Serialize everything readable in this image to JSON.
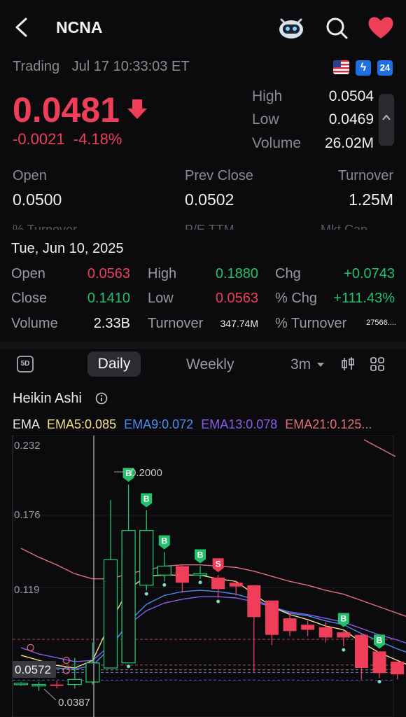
{
  "header": {
    "title": "NCNA"
  },
  "status": {
    "state": "Trading",
    "timestamp": "Jul 17 10:33:03 ET",
    "badge_24": "24"
  },
  "quote": {
    "price": "0.0481",
    "change": "-0.0021",
    "change_pct": "-4.18%",
    "high_label": "High",
    "high": "0.0504",
    "low_label": "Low",
    "low": "0.0469",
    "volume_label": "Volume",
    "volume": "26.02M",
    "open_label": "Open",
    "open": "0.0500",
    "prev_close_label": "Prev Close",
    "prev_close": "0.0502",
    "turnover_label": "Turnover",
    "turnover": "1.25M",
    "faded_labels": [
      "% Turnover",
      "P/E TTM",
      "Mkt Cap"
    ]
  },
  "day_panel": {
    "date": "Tue, Jun 10, 2025",
    "open_label": "Open",
    "open": "0.0563",
    "high_label": "High",
    "high": "0.1880",
    "chg_label": "Chg",
    "chg": "+0.0743",
    "close_label": "Close",
    "close": "0.1410",
    "low_label": "Low",
    "low": "0.0563",
    "pct_chg_label": "% Chg",
    "pct_chg": "+111.43%",
    "volume_label": "Volume",
    "volume": "2.33B",
    "turnover_label": "Turnover",
    "turnover": "347.74M",
    "pct_turnover_label": "% Turnover",
    "pct_turnover": "27566...."
  },
  "tabs": {
    "five_day": "5D",
    "daily": "Daily",
    "weekly": "Weekly",
    "range": "3m"
  },
  "chart_title": "Heikin Ashi",
  "ema": {
    "label": "EMA",
    "ema5": "EMA5:0.085",
    "ema9": "EMA9:0.072",
    "ema13": "EMA13:0.078",
    "ema21": "EMA21:0.125..."
  },
  "colors": {
    "up": "#23c16b",
    "down": "#ef3e5a",
    "ema5": "#f5e08a",
    "ema9": "#4a8df0",
    "ema13": "#8a5cf0",
    "ema21": "#e0707a"
  },
  "chart_data": {
    "type": "candlestick",
    "y_ticks": [
      "0.232",
      "0.176",
      "0.119"
    ],
    "price_tag": "0.0572",
    "high_marker": "0.2000",
    "low_marker": "0.0387",
    "candles": [
      {
        "o": 0.043,
        "c": 0.044,
        "h": 0.045,
        "l": 0.042,
        "up": true
      },
      {
        "o": 0.042,
        "c": 0.043,
        "h": 0.045,
        "l": 0.038,
        "up": true
      },
      {
        "o": 0.042,
        "c": 0.043,
        "h": 0.046,
        "l": 0.04,
        "up": false
      },
      {
        "o": 0.043,
        "c": 0.047,
        "h": 0.064,
        "l": 0.04,
        "up": true
      },
      {
        "o": 0.045,
        "c": 0.06,
        "h": 0.076,
        "l": 0.043,
        "up": true
      },
      {
        "o": 0.056,
        "c": 0.141,
        "h": 0.188,
        "l": 0.056,
        "up": true
      },
      {
        "o": 0.06,
        "c": 0.164,
        "h": 0.2,
        "l": 0.06,
        "up": true
      },
      {
        "o": 0.121,
        "c": 0.164,
        "h": 0.18,
        "l": 0.117,
        "up": true
      },
      {
        "o": 0.129,
        "c": 0.136,
        "h": 0.147,
        "l": 0.124,
        "up": true
      },
      {
        "o": 0.136,
        "c": 0.123,
        "h": 0.137,
        "l": 0.115,
        "up": false
      },
      {
        "o": 0.13,
        "c": 0.129,
        "h": 0.136,
        "l": 0.126,
        "up": true
      },
      {
        "o": 0.127,
        "c": 0.118,
        "h": 0.129,
        "l": 0.111,
        "up": false
      },
      {
        "o": 0.123,
        "c": 0.12,
        "h": 0.124,
        "l": 0.113,
        "up": false
      },
      {
        "o": 0.121,
        "c": 0.096,
        "h": 0.121,
        "l": 0.053,
        "up": false
      },
      {
        "o": 0.109,
        "c": 0.082,
        "h": 0.109,
        "l": 0.074,
        "up": false
      },
      {
        "o": 0.095,
        "c": 0.085,
        "h": 0.099,
        "l": 0.081,
        "up": false
      },
      {
        "o": 0.09,
        "c": 0.086,
        "h": 0.093,
        "l": 0.081,
        "up": false
      },
      {
        "o": 0.088,
        "c": 0.08,
        "h": 0.092,
        "l": 0.076,
        "up": false
      },
      {
        "o": 0.084,
        "c": 0.08,
        "h": 0.086,
        "l": 0.073,
        "up": false
      },
      {
        "o": 0.082,
        "c": 0.056,
        "h": 0.083,
        "l": 0.047,
        "up": false
      },
      {
        "o": 0.069,
        "c": 0.052,
        "h": 0.069,
        "l": 0.048,
        "up": false
      },
      {
        "o": 0.061,
        "c": 0.051,
        "h": 0.061,
        "l": 0.047,
        "up": false
      },
      {
        "o": 0.056,
        "c": 0.048,
        "h": 0.056,
        "l": 0.046,
        "up": false
      }
    ],
    "ema5": [
      0.066,
      0.062,
      0.058,
      0.056,
      0.062,
      0.092,
      0.118,
      0.128,
      0.129,
      0.129,
      0.129,
      0.126,
      0.124,
      0.114,
      0.104,
      0.098,
      0.094,
      0.089,
      0.086,
      0.076,
      0.068,
      0.062,
      0.056
    ],
    "ema9": [
      0.06,
      0.058,
      0.056,
      0.055,
      0.058,
      0.072,
      0.092,
      0.106,
      0.113,
      0.116,
      0.117,
      0.116,
      0.114,
      0.11,
      0.104,
      0.099,
      0.097,
      0.093,
      0.09,
      0.083,
      0.077,
      0.071,
      0.066
    ],
    "ema13": [
      0.072,
      0.067,
      0.064,
      0.061,
      0.062,
      0.074,
      0.09,
      0.101,
      0.107,
      0.11,
      0.112,
      0.112,
      0.111,
      0.108,
      0.104,
      0.1,
      0.098,
      0.095,
      0.092,
      0.087,
      0.082,
      0.078,
      0.073
    ],
    "ema21": [
      0.15,
      0.143,
      0.137,
      0.13,
      0.126,
      0.126,
      0.13,
      0.133,
      0.136,
      0.137,
      0.137,
      0.136,
      0.135,
      0.132,
      0.128,
      0.124,
      0.121,
      0.117,
      0.114,
      0.109,
      0.104,
      0.099,
      0.094
    ],
    "signals": [
      {
        "i": 6,
        "type": "B"
      },
      {
        "i": 7,
        "type": "B"
      },
      {
        "i": 8,
        "type": "B"
      },
      {
        "i": 10,
        "type": "B"
      },
      {
        "i": 11,
        "type": "S"
      },
      {
        "i": 18,
        "type": "B"
      },
      {
        "i": 20,
        "type": "B"
      }
    ]
  }
}
